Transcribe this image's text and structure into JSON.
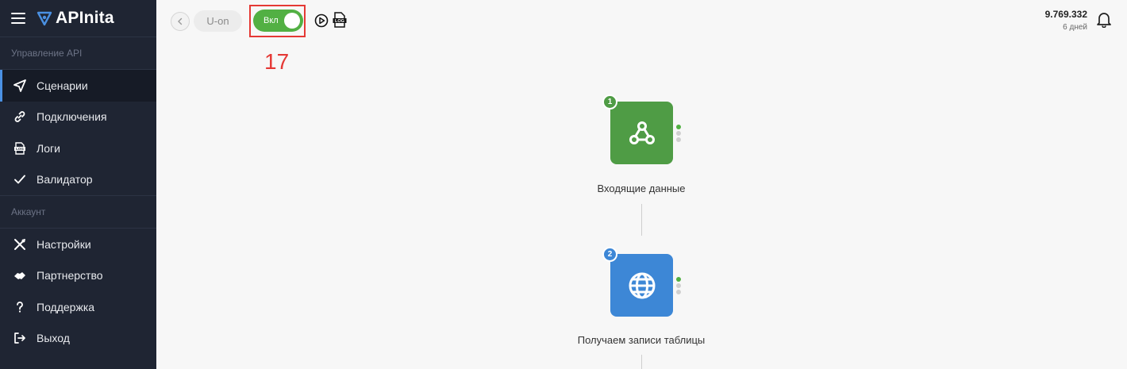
{
  "app": {
    "brand": "APInita"
  },
  "sidebar": {
    "section_api": "Управление API",
    "section_account": "Аккаунт",
    "api_items": [
      {
        "label": "Сценарии",
        "icon": "send-icon",
        "active": true
      },
      {
        "label": "Подключения",
        "icon": "link-icon"
      },
      {
        "label": "Логи",
        "icon": "log-icon"
      },
      {
        "label": "Валидатор",
        "icon": "check-icon"
      }
    ],
    "account_items": [
      {
        "label": "Настройки",
        "icon": "tools-icon"
      },
      {
        "label": "Партнерство",
        "icon": "handshake-icon"
      },
      {
        "label": "Поддержка",
        "icon": "question-icon"
      },
      {
        "label": "Выход",
        "icon": "logout-icon"
      }
    ]
  },
  "topbar": {
    "scenario_name": "U-on",
    "toggle_label": "Вкл",
    "log_label": "LOG",
    "annotation": "17",
    "balance": "9.769.332",
    "days": "6 дней"
  },
  "flow": {
    "nodes": [
      {
        "number": "1",
        "label": "Входящие данные",
        "icon": "webhook-icon",
        "color": "#4f9c45"
      },
      {
        "number": "2",
        "label": "Получаем записи таблицы",
        "icon": "globe-icon",
        "color": "#3d87d6"
      }
    ]
  },
  "colors": {
    "sidebar": "#1f2533",
    "accent": "#4a90e2",
    "toggle_on": "#52b043",
    "highlight": "#e53935"
  }
}
